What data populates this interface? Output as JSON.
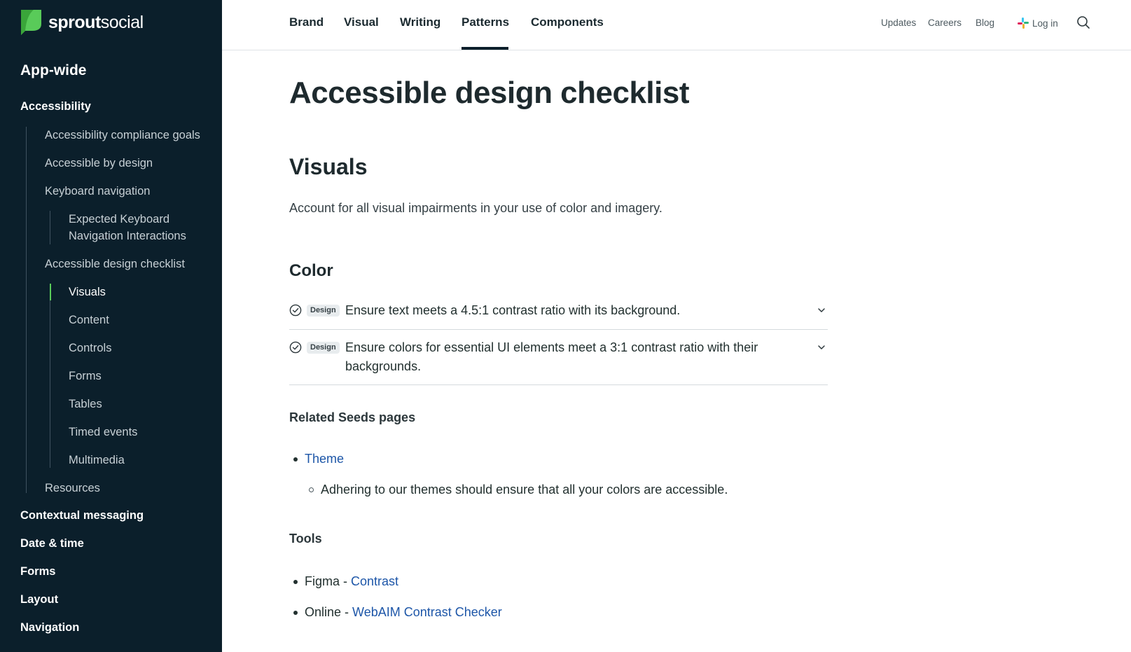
{
  "brand": {
    "name_bold": "sprout",
    "name_regular": "social"
  },
  "header": {
    "nav": [
      "Brand",
      "Visual",
      "Writing",
      "Patterns",
      "Components"
    ],
    "active_nav": "Patterns",
    "utility": [
      "Updates",
      "Careers",
      "Blog"
    ],
    "login_label": "Log in"
  },
  "sidebar": {
    "section_title": "App-wide",
    "accessibility": "Accessibility",
    "l2": {
      "compliance": "Accessibility compliance goals",
      "by_design": "Accessible by design",
      "keyboard": "Keyboard navigation",
      "checklist": "Accessible design checklist",
      "resources": "Resources"
    },
    "keyboard_children": [
      "Expected Keyboard Navigation Interactions"
    ],
    "checklist_children": [
      "Visuals",
      "Content",
      "Controls",
      "Forms",
      "Tables",
      "Timed events",
      "Multimedia"
    ],
    "active_item": "Visuals",
    "bottom": [
      "Contextual messaging",
      "Date & time",
      "Forms",
      "Layout",
      "Navigation"
    ]
  },
  "main": {
    "title": "Accessible design checklist",
    "section": "Visuals",
    "intro": "Account for all visual impairments in your use of color and imagery.",
    "subsection": "Color",
    "checklist": [
      {
        "badge": "Design",
        "text": "Ensure text meets a 4.5:1 contrast ratio with its background."
      },
      {
        "badge": "Design",
        "text": "Ensure colors for essential UI elements meet a 3:1 contrast ratio with their backgrounds."
      }
    ],
    "related_heading": "Related Seeds pages",
    "related": {
      "link": "Theme",
      "note": "Adhering to our themes should ensure that all your colors are accessible."
    },
    "tools_heading": "Tools",
    "tools": [
      {
        "prefix": "Figma - ",
        "link": "Contrast"
      },
      {
        "prefix": "Online - ",
        "link": "WebAIM Contrast Checker"
      }
    ]
  },
  "colors": {
    "sidebar_bg": "#0b1f2b",
    "accent_green": "#59cb59",
    "link": "#1d56a8"
  },
  "icons": {
    "logo": "sprout-leaf-icon",
    "login": "slack-icon",
    "search": "search-icon",
    "check": "check-circle-icon",
    "expand": "chevron-down-icon"
  }
}
